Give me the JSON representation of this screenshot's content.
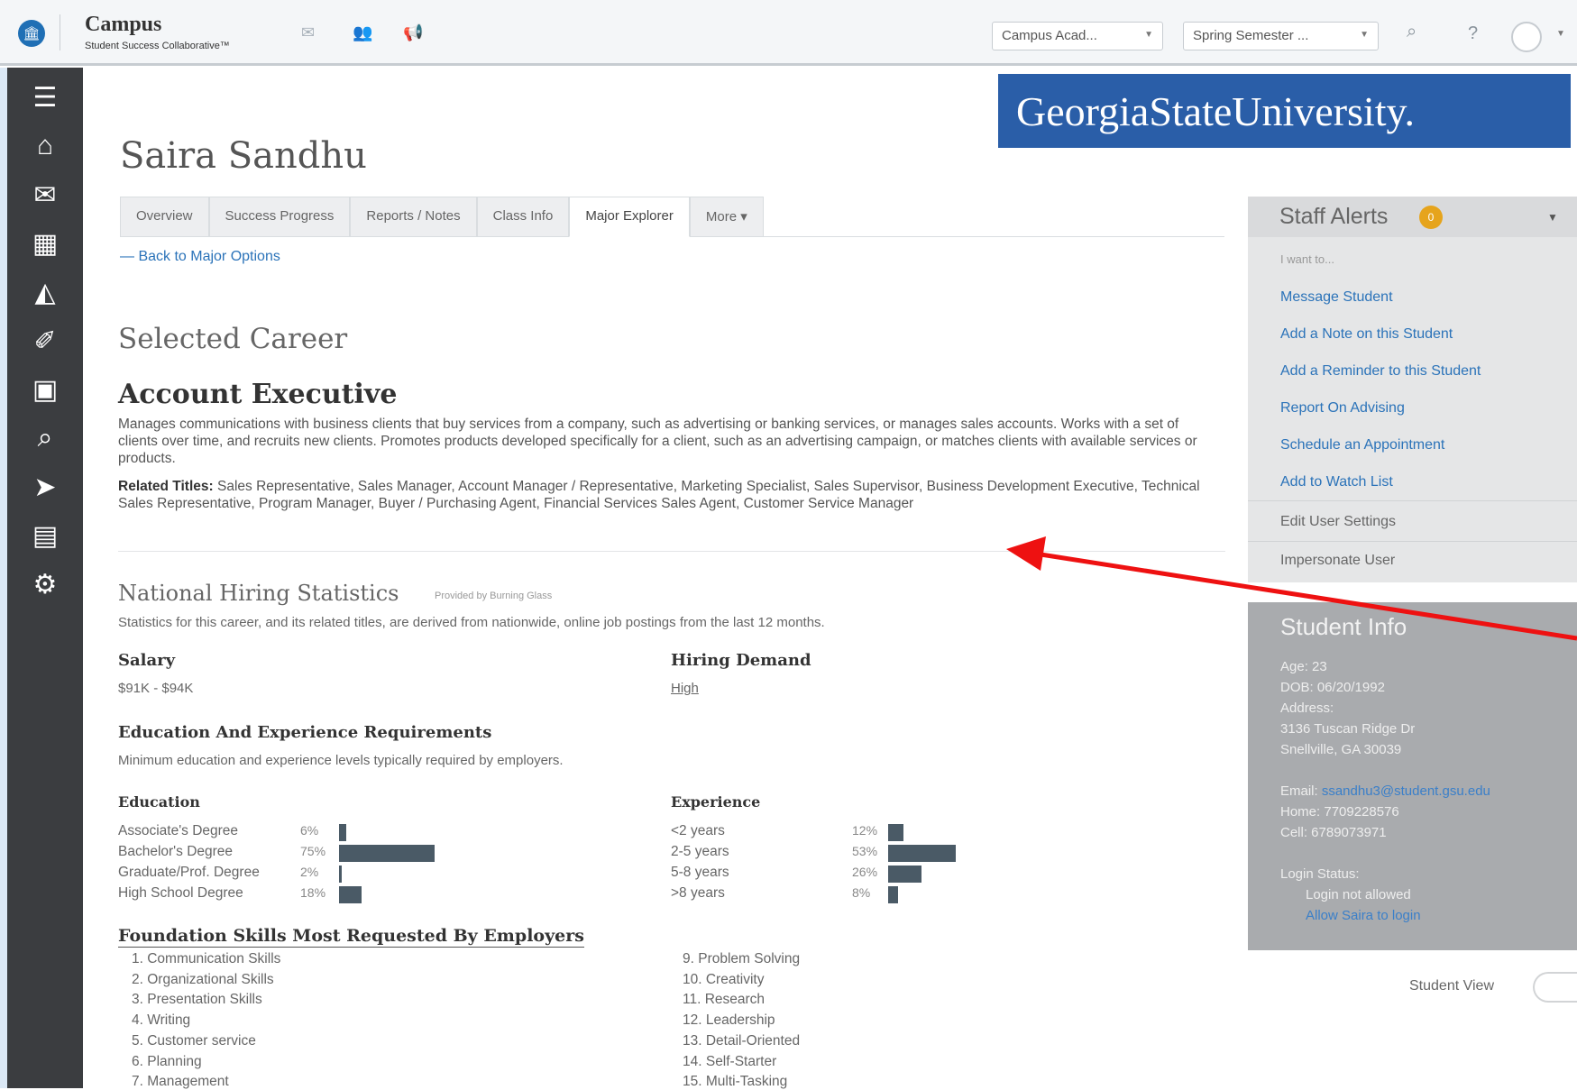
{
  "header": {
    "brand_title": "Campus",
    "brand_subtitle": "Student Success Collaborative™",
    "institution_select": "Campus Acad...",
    "term_select": "Spring Semester ...",
    "icons": [
      "mail-icon",
      "people-icon",
      "megaphone-icon",
      "search-icon",
      "help-icon",
      "avatar-icon"
    ]
  },
  "sidebar": {
    "icons": [
      "menu-icon",
      "home-icon",
      "mail-icon",
      "calendar-icon",
      "reports-icon",
      "pin-icon",
      "book-icon",
      "search-icon",
      "tag-icon",
      "list-icon",
      "gear-icon"
    ]
  },
  "banner": {
    "text": "GeorgiaStateUniversity."
  },
  "student": {
    "name": "Saira Sandhu"
  },
  "tabs": [
    {
      "label": "Overview"
    },
    {
      "label": "Success Progress"
    },
    {
      "label": "Reports / Notes"
    },
    {
      "label": "Class Info"
    },
    {
      "label": "Major Explorer",
      "active": true
    },
    {
      "label": "More ▾"
    }
  ],
  "back_link": "— Back to Major Options",
  "career": {
    "section_heading": "Selected Career",
    "title": "Account Executive",
    "description": "Manages communications with business clients that buy services from a company, such as advertising or banking services, or manages sales accounts. Works with a set of clients over time, and recruits new clients. Promotes products developed specifically for a client, such as an advertising campaign, or matches clients with available services or products.",
    "related_label": "Related Titles:",
    "related_titles": "Sales Representative, Sales Manager, Account Manager / Representative, Marketing Specialist, Sales Supervisor, Business Development Executive, Technical Sales Representative, Program Manager, Buyer / Purchasing Agent, Financial Services Sales Agent, Customer Service Manager"
  },
  "stats": {
    "heading": "National Hiring Statistics",
    "provided_by": "Provided by Burning Glass",
    "description": "Statistics for this career, and its related titles, are derived from nationwide, online job postings from the last 12 months.",
    "salary_label": "Salary",
    "salary_value": "$91K - $94K",
    "demand_label": "Hiring Demand",
    "demand_value": "High",
    "req_heading": "Education And Experience Requirements",
    "req_desc": "Minimum education and experience levels typically required by employers.",
    "education_label": "Education",
    "experience_label": "Experience",
    "education": [
      {
        "name": "Associate's Degree",
        "pct_label": "6%",
        "value": 6
      },
      {
        "name": "Bachelor's Degree",
        "pct_label": "75%",
        "value": 75
      },
      {
        "name": "Graduate/Prof. Degree",
        "pct_label": "2%",
        "value": 2
      },
      {
        "name": "High School Degree",
        "pct_label": "18%",
        "value": 18
      }
    ],
    "experience": [
      {
        "name": "<2 years",
        "pct_label": "12%",
        "value": 12
      },
      {
        "name": "2-5 years",
        "pct_label": "53%",
        "value": 53
      },
      {
        "name": "5-8 years",
        "pct_label": "26%",
        "value": 26
      },
      {
        "name": ">8 years",
        "pct_label": "8%",
        "value": 8
      }
    ]
  },
  "skills": {
    "heading": "Foundation Skills Most Requested By Employers",
    "left": [
      "1. Communication Skills",
      "2. Organizational Skills",
      "3. Presentation Skills",
      "4. Writing",
      "5. Customer service",
      "6. Planning",
      "7. Management"
    ],
    "right": [
      "9. Problem Solving",
      "10. Creativity",
      "11. Research",
      "12. Leadership",
      "13. Detail-Oriented",
      "14. Self-Starter",
      "15. Multi-Tasking"
    ]
  },
  "alerts": {
    "title": "Staff Alerts",
    "badge": "0",
    "want_to": "I want to...",
    "actions": [
      "Message Student",
      "Add a Note on this Student",
      "Add a Reminder to this Student",
      "Report On Advising",
      "Schedule an Appointment",
      "Add to Watch List"
    ],
    "plain_actions": [
      "Edit User Settings",
      "Impersonate User"
    ]
  },
  "student_info": {
    "title": "Student Info",
    "age": "Age: 23",
    "dob": "DOB: 06/20/1992",
    "address_label": "Address:",
    "address_line1": "3136 Tuscan Ridge Dr",
    "address_line2": "Snellville, GA 30039",
    "email_label": "Email: ",
    "email": "ssandhu3@student.gsu.edu",
    "home": "Home: 7709228576",
    "cell": "Cell: 6789073971",
    "login_label": "Login Status:",
    "login_value": "Login not allowed",
    "login_link": "Allow Saira to login"
  },
  "student_view": {
    "label": "Student View"
  },
  "colors": {
    "accent_link": "#2b73b9",
    "sidebar": "#3b3d40",
    "bar": "#4a5a66",
    "badge": "#e6a41c",
    "banner": "#2a5ea8",
    "annotation": "#e11"
  }
}
